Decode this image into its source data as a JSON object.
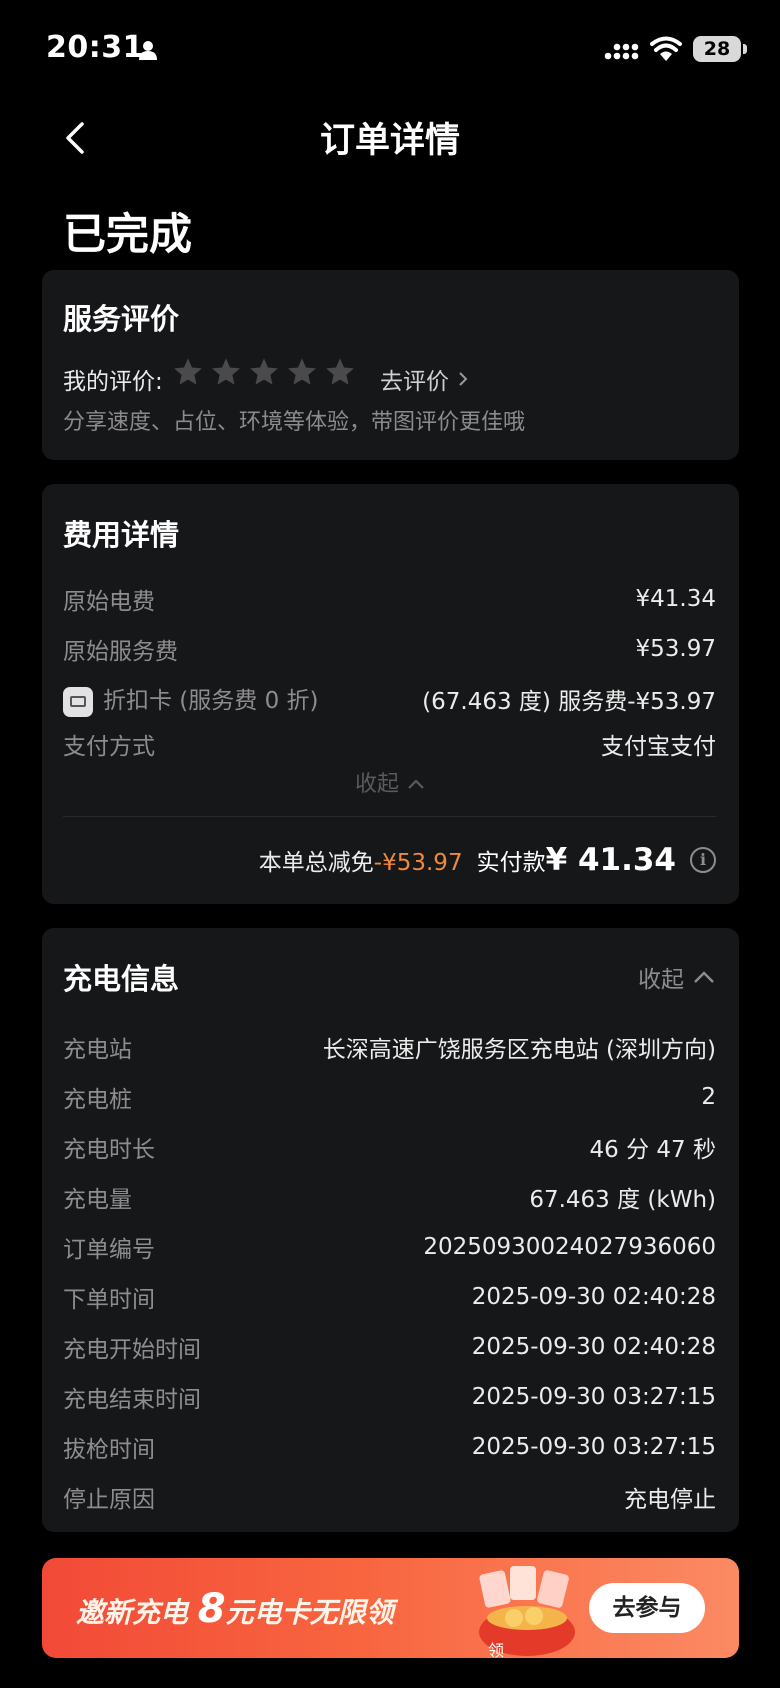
{
  "status_bar": {
    "time": "20:31",
    "battery": "28"
  },
  "nav": {
    "title": "订单详情"
  },
  "order_status": "已完成",
  "rating": {
    "title": "服务评价",
    "label": "我的评价:",
    "go_label": "去评价",
    "hint": "分享速度、占位、环境等体验，带图评价更佳哦",
    "stars": 5
  },
  "fees": {
    "title": "费用详情",
    "items": [
      {
        "label": "原始电费",
        "value": "¥41.34"
      },
      {
        "label": "原始服务费",
        "value": "¥53.97"
      },
      {
        "label": "折扣卡 (服务费 0 折)",
        "value": "(67.463 度) 服务费-¥53.97"
      },
      {
        "label": "支付方式",
        "value": "支付宝支付"
      }
    ],
    "collapse_label": "收起",
    "total_discount_label": "本单总减免",
    "total_discount_value": "-¥53.97",
    "paid_label": "实付款",
    "paid_value": "¥ 41.34"
  },
  "charging": {
    "title": "充电信息",
    "collapse_label": "收起",
    "items": [
      {
        "label": "充电站",
        "value": "长深高速广饶服务区充电站 (深圳方向)"
      },
      {
        "label": "充电桩",
        "value": "2"
      },
      {
        "label": "充电时长",
        "value": "46 分 47 秒"
      },
      {
        "label": "充电量",
        "value": "67.463 度 (kWh)"
      },
      {
        "label": "订单编号",
        "value": "20250930024027936060"
      },
      {
        "label": "下单时间",
        "value": "2025-09-30 02:40:28"
      },
      {
        "label": "充电开始时间",
        "value": "2025-09-30 02:40:28"
      },
      {
        "label": "充电结束时间",
        "value": "2025-09-30 03:27:15"
      },
      {
        "label": "拔枪时间",
        "value": "2025-09-30 03:27:15"
      },
      {
        "label": "停止原因",
        "value": "充电停止"
      }
    ]
  },
  "banner": {
    "text_prefix": "邀新充电",
    "amount": "8",
    "text_suffix": "元电卡无限领",
    "button": "去参与",
    "gift_label": "领"
  },
  "colors": {
    "accent": "#f0893a",
    "card_bg": "#161719",
    "banner": "#f24a37"
  }
}
